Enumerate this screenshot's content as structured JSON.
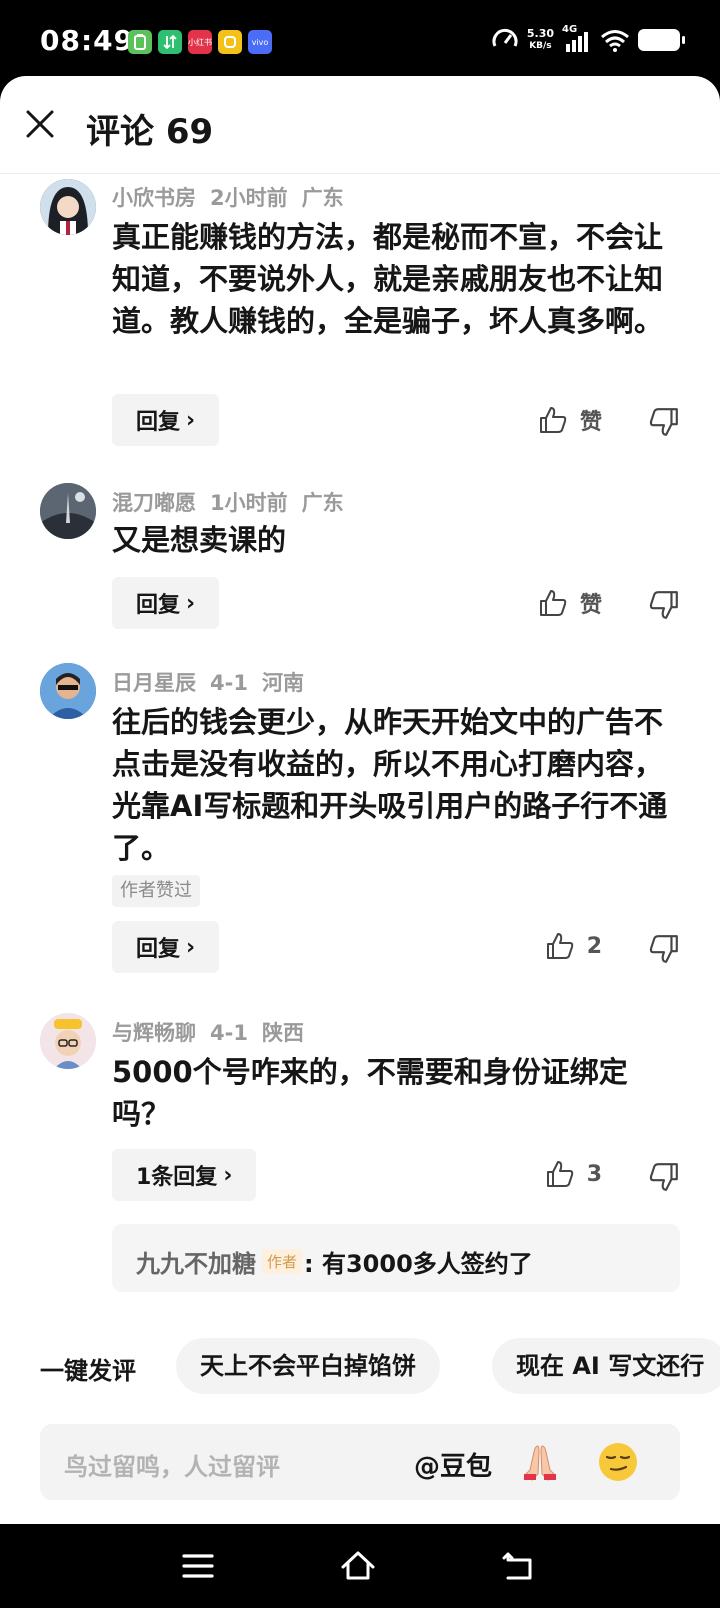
{
  "status_bar": {
    "time": "08:49",
    "net_speed_value": "5.30",
    "net_speed_unit": "KB/s",
    "network": "4G",
    "app_icons": [
      {
        "name": "battery-saver-app-icon",
        "label": "",
        "color": "#5bc25b"
      },
      {
        "name": "transfer-app-icon",
        "label": "",
        "color": "#2fbf71"
      },
      {
        "name": "xiaohongshu-app-icon",
        "label": "小红书",
        "color": "#e2334b"
      },
      {
        "name": "yellow-app-icon",
        "label": "",
        "color": "#f2c21b"
      },
      {
        "name": "vivo-app-icon",
        "label": "vivo",
        "color": "#4a6cf7"
      }
    ]
  },
  "header": {
    "title": "评论 69"
  },
  "comments": [
    {
      "author": "小欣书房",
      "time": "2小时前",
      "location": "广东",
      "text": "真正能赚钱的方法，都是秘而不宣，不会让知道，不要说外人，就是亲戚朋友也不让知道。教人赚钱的，全是骗子，坏人真多啊。",
      "reply_label": "回复",
      "like_label": "赞"
    },
    {
      "author": "混刀嘟愿",
      "time": "1小时前",
      "location": "广东",
      "text": "又是想卖课的",
      "reply_label": "回复",
      "like_label": "赞"
    },
    {
      "author": "日月星辰",
      "time": "4-1",
      "location": "河南",
      "text": "往后的钱会更少，从昨天开始文中的广告不点击是没有收益的，所以不用心打磨内容，光靠AI写标题和开头吸引用户的路子行不通了。",
      "author_liked": "作者赞过",
      "reply_label": "回复",
      "like_label": "2"
    },
    {
      "author": "与辉畅聊",
      "time": "4-1",
      "location": "陕西",
      "text": "5000个号咋来的，不需要和身份证绑定吗？",
      "reply_label": "1条回复",
      "like_label": "3",
      "sub_reply": {
        "name": "九九不加糖",
        "tag": "作者",
        "text": ": 有3000多人签约了"
      }
    }
  ],
  "quick_comment": {
    "label": "一键发评",
    "chips": [
      "天上不会平白掉馅饼",
      "现在 AI 写文还行"
    ]
  },
  "input": {
    "placeholder": "鸟过留鸣，人过留评",
    "mention": "@豆包",
    "emojis": [
      "praying-hands-emoji",
      "smirk-emoji"
    ]
  },
  "colors": {
    "text_primary": "#161616",
    "text_meta": "#9a9a9a",
    "button_bg": "#f3f3f3",
    "author_tag": "#d39a4b"
  }
}
